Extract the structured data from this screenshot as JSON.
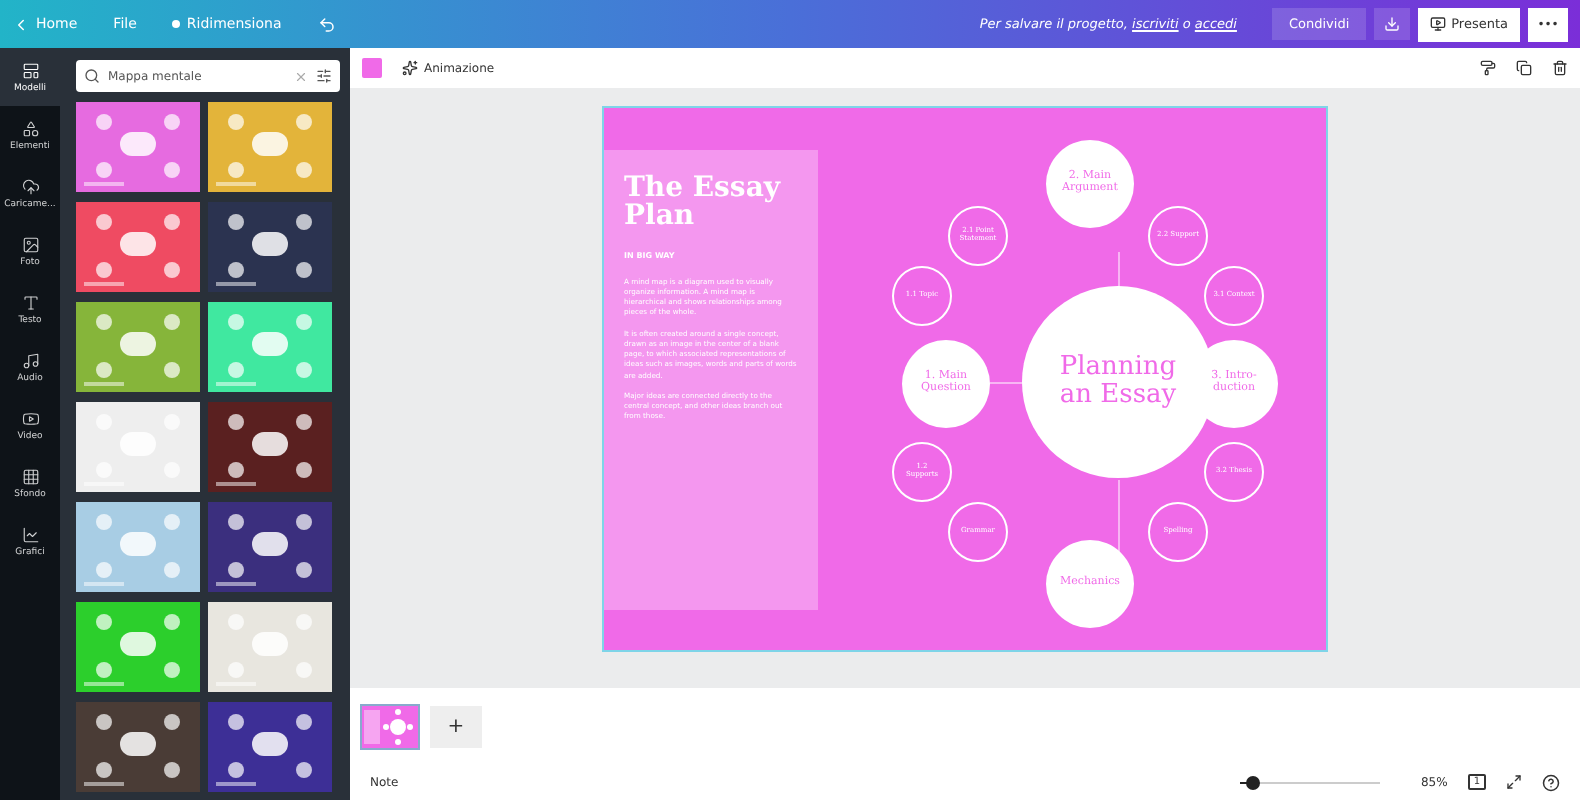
{
  "topbar": {
    "nav": [
      {
        "label": "Home"
      },
      {
        "label": "File"
      },
      {
        "label": "Ridimensiona"
      }
    ],
    "save_note": {
      "text": "Per salvare il progetto, ",
      "link1": "iscriviti",
      "mid": " o ",
      "link2": "accedi"
    },
    "share": "Condividi",
    "present": "Presenta",
    "more": "•••"
  },
  "rail": [
    {
      "label": "Modelli",
      "selected": true
    },
    {
      "label": "Elementi",
      "selected": false
    },
    {
      "label": "Caricame...",
      "selected": false
    },
    {
      "label": "Foto",
      "selected": false
    },
    {
      "label": "Testo",
      "selected": false
    },
    {
      "label": "Audio",
      "selected": false
    },
    {
      "label": "Video",
      "selected": false
    },
    {
      "label": "Sfondo",
      "selected": false
    },
    {
      "label": "Grafici",
      "selected": false
    }
  ],
  "search": {
    "value": "Mappa mentale"
  },
  "templates": [
    {
      "color": "#e66be0"
    },
    {
      "color": "#e3b43a"
    },
    {
      "color": "#ef4b62"
    },
    {
      "color": "#2b3350"
    },
    {
      "color": "#86b53a"
    },
    {
      "color": "#40e8a0"
    },
    {
      "color": "#eeeeee"
    },
    {
      "color": "#5a2020"
    },
    {
      "color": "#a8cde4"
    },
    {
      "color": "#3b2f7e"
    },
    {
      "color": "#2ccf2c"
    },
    {
      "color": "#e8e6df"
    },
    {
      "color": "#4a3c36"
    },
    {
      "color": "#3d2f96"
    }
  ],
  "toolbar": {
    "color": "#f06ae8",
    "animation": "Animazione"
  },
  "slide": {
    "title": "The Essay Plan",
    "subtitle": "IN BIG WAY",
    "paragraphs": [
      "A mind map is a diagram used to visually organize information. A mind map is hierarchical and shows relationships among pieces of the whole.",
      "It is often created around a single concept, drawn as an image in the center of a blank page, to which associated representations of ideas such as images, words and parts of words are added.",
      "Major ideas are connected directly to the central concept, and other ideas branch out from those."
    ],
    "center": "Planning an Essay",
    "main_nodes": [
      {
        "label": "2. Main Argument"
      },
      {
        "label": "1. Main Question"
      },
      {
        "label": "3. Intro-duction"
      },
      {
        "label": "Mechanics"
      }
    ],
    "small_nodes": [
      {
        "label": "2.1 Point Statement"
      },
      {
        "label": "2.2 Support"
      },
      {
        "label": "1.1 Topic"
      },
      {
        "label": "3.1 Context"
      },
      {
        "label": "1.2 Supports"
      },
      {
        "label": "3.2 Thesis"
      },
      {
        "label": "Grammar"
      },
      {
        "label": "Spelling"
      }
    ]
  },
  "pages": {
    "add": "+"
  },
  "footer": {
    "notes": "Note",
    "level": 0.08,
    "zoom": "85%",
    "page_count": "1"
  }
}
